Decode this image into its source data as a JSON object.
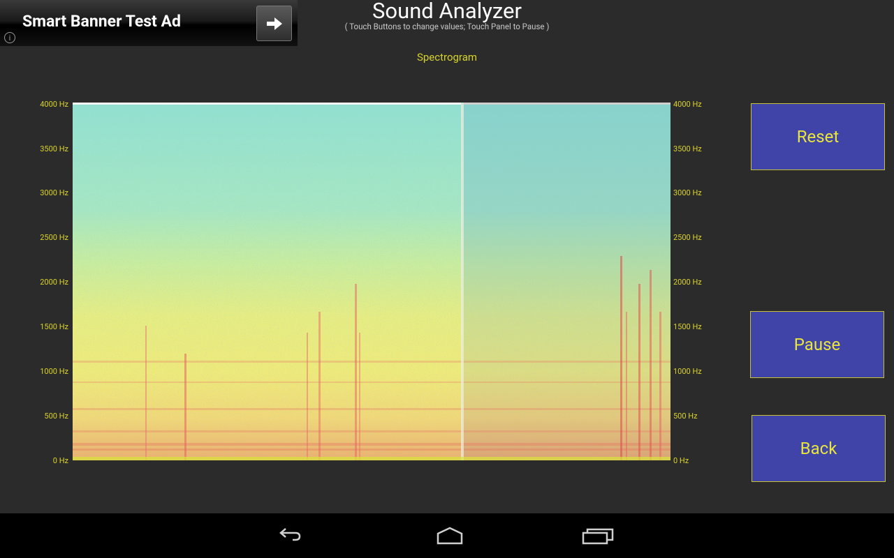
{
  "ad": {
    "title": "Smart Banner Test Ad",
    "info_icon": "info-icon",
    "arrow_icon": "arrow-right-icon"
  },
  "header": {
    "title": "Sound Analyzer",
    "subtitle": "( Touch Buttons to change values; Touch Panel to Pause )"
  },
  "chart_label": "Spectrogram",
  "chart_data": {
    "type": "heatmap",
    "title": "Spectrogram",
    "y_ticks": [
      "4000 Hz",
      "3500 Hz",
      "3000 Hz",
      "2500 Hz",
      "2000 Hz",
      "1500 Hz",
      "1000 Hz",
      "500 Hz",
      "0 Hz"
    ],
    "ylim": [
      0,
      4000
    ],
    "y_unit": "Hz",
    "colormap": [
      "#3f8fd8",
      "#7fe0d8",
      "#c8ee9a",
      "#f0e878",
      "#e89a70",
      "#e85060"
    ]
  },
  "buttons": {
    "reset": "Reset",
    "pause": "Pause",
    "back": "Back"
  },
  "navbar": {
    "back_icon": "back-icon",
    "home_icon": "home-icon",
    "recents_icon": "recents-icon"
  },
  "colors": {
    "background": "#2b2b2b",
    "accent_text": "#d9d32a",
    "button_fill": "#4044a8",
    "button_border": "#c8c23a"
  }
}
